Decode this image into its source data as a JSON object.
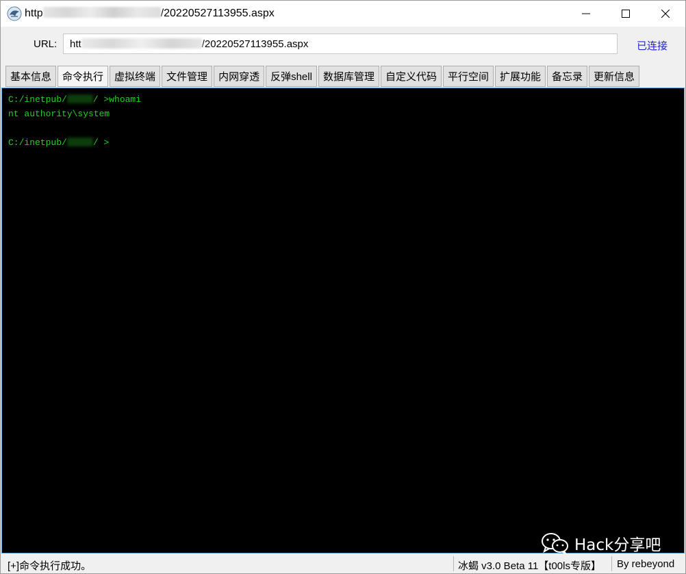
{
  "window": {
    "title_prefix": "http",
    "title_suffix": "/20220527113955.aspx"
  },
  "urlbar": {
    "label": "URL:",
    "value_prefix": "htt",
    "value_suffix": "/20220527113955.aspx",
    "status": "已连接"
  },
  "tabs": [
    {
      "label": "基本信息"
    },
    {
      "label": "命令执行",
      "active": true
    },
    {
      "label": "虚拟终端"
    },
    {
      "label": "文件管理"
    },
    {
      "label": "内网穿透"
    },
    {
      "label": "反弹shell"
    },
    {
      "label": "数据库管理"
    },
    {
      "label": "自定义代码"
    },
    {
      "label": "平行空间"
    },
    {
      "label": "扩展功能"
    },
    {
      "label": "备忘录"
    },
    {
      "label": "更新信息"
    }
  ],
  "terminal": {
    "line1_prefix": "C:/inetpub/",
    "line1_suffix": "/ >whoami",
    "line2": "nt authority\\system",
    "line4_prefix": "C:/inetpub/",
    "line4_suffix": "/ >"
  },
  "watermark": {
    "text": "Hack分享吧"
  },
  "statusbar": {
    "message": "[+]命令执行成功。",
    "version": "冰蝎 v3.0 Beta 11【t00ls专版】",
    "author": "By rebeyond"
  },
  "colors": {
    "terminal_text": "#22d122",
    "terminal_bg": "#000000",
    "connected": "#2222cc"
  },
  "icons": [
    "behinder-app-icon",
    "minimize-icon",
    "maximize-icon",
    "close-icon",
    "wechat-icon"
  ]
}
